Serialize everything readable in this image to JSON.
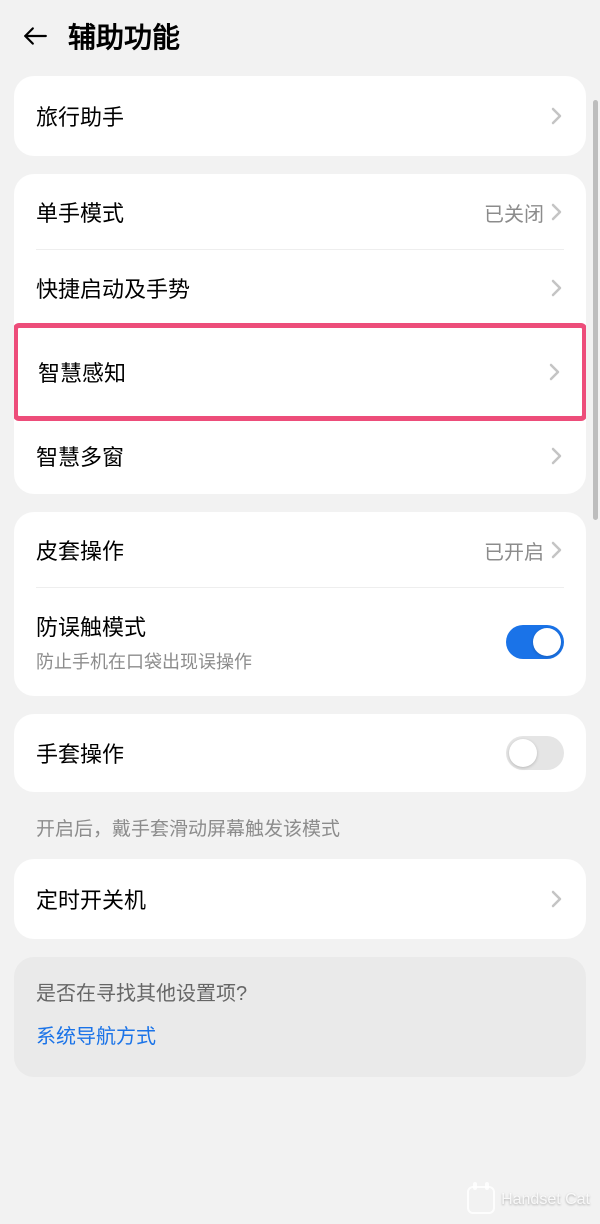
{
  "header": {
    "title": "辅助功能"
  },
  "group1": {
    "travel_assistant": "旅行助手"
  },
  "group2": {
    "one_hand": {
      "label": "单手模式",
      "value": "已关闭"
    },
    "gestures": "快捷启动及手势",
    "smart_sense": "智慧感知",
    "smart_window": "智慧多窗"
  },
  "group3": {
    "cover": {
      "label": "皮套操作",
      "value": "已开启"
    },
    "mistouch": {
      "label": "防误触模式",
      "desc": "防止手机在口袋出现误操作"
    }
  },
  "group4": {
    "glove": "手套操作",
    "glove_hint": "开启后，戴手套滑动屏幕触发该模式"
  },
  "group5": {
    "schedule": "定时开关机"
  },
  "search": {
    "title": "是否在寻找其他设置项?",
    "link": "系统导航方式"
  },
  "watermark": "Handset Cat"
}
